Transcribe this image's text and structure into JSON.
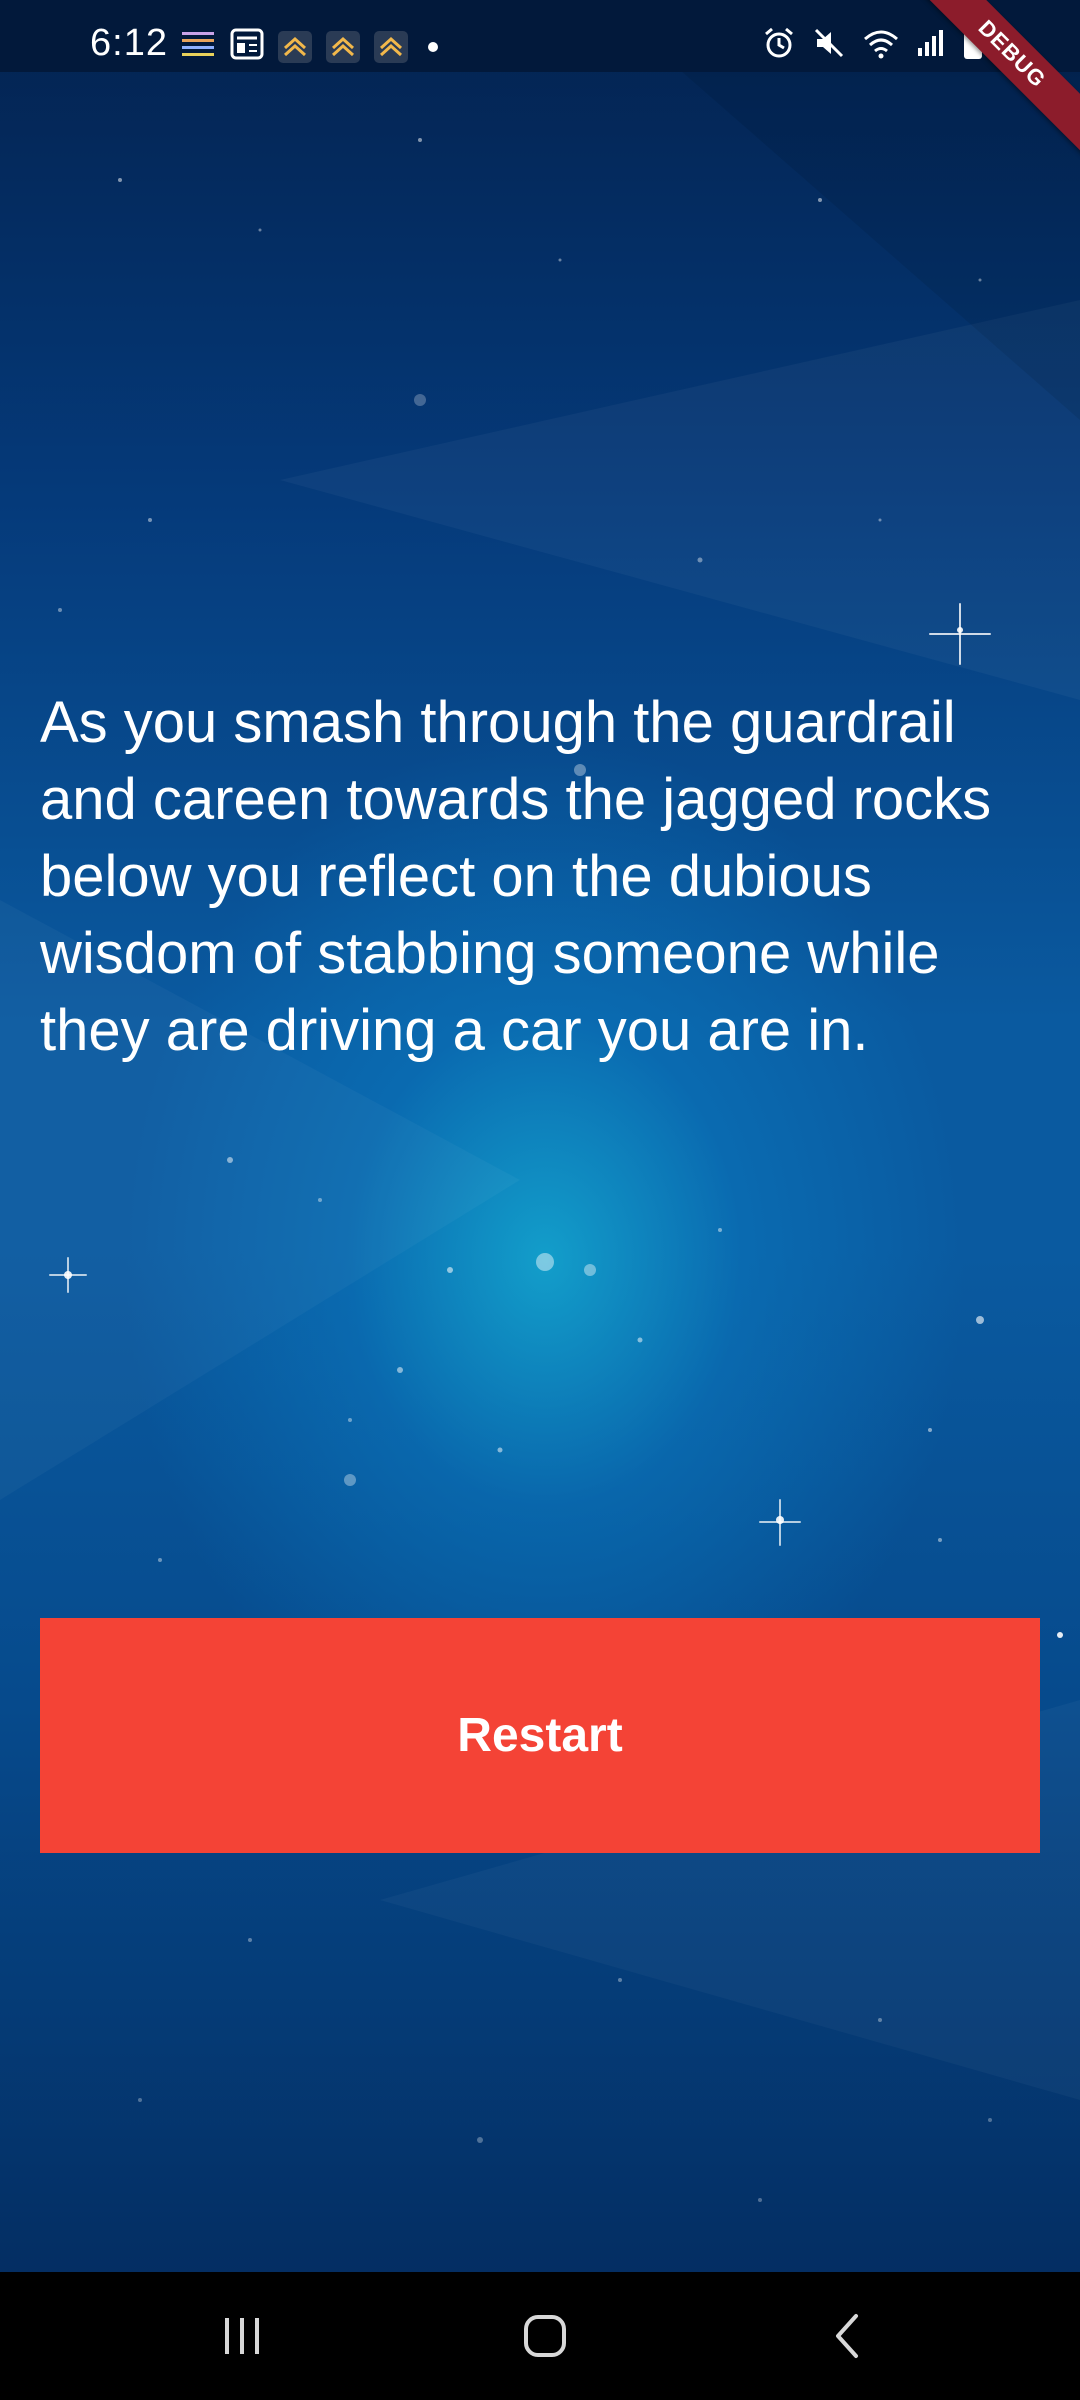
{
  "status_bar": {
    "time": "6:12",
    "debug_label": "DEBUG",
    "left_icons": [
      "app-notification-icon",
      "news-icon",
      "fan-app-icon",
      "fan-app-icon",
      "fan-app-icon",
      "more-dot-icon"
    ],
    "right_icons": [
      "alarm-icon",
      "mute-icon",
      "wifi-icon",
      "signal-icon",
      "battery-icon"
    ]
  },
  "story": {
    "text": "As you smash through the guardrail and careen towards the jagged rocks below you reflect on the dubious wisdom of stabbing someone while they are driving a car you are in."
  },
  "restart_button": {
    "label": "Restart",
    "color": "#f44336"
  },
  "nav_bar": {
    "buttons": [
      "recents-icon",
      "home-icon",
      "back-icon"
    ]
  },
  "theme": {
    "background_top": "#03224f",
    "background_center": "#0a5aa0",
    "status_bar_bg": "#02193b",
    "debug_ribbon": "#8c1c2b",
    "nav_bar_bg": "#000000",
    "text": "#ffffff"
  }
}
